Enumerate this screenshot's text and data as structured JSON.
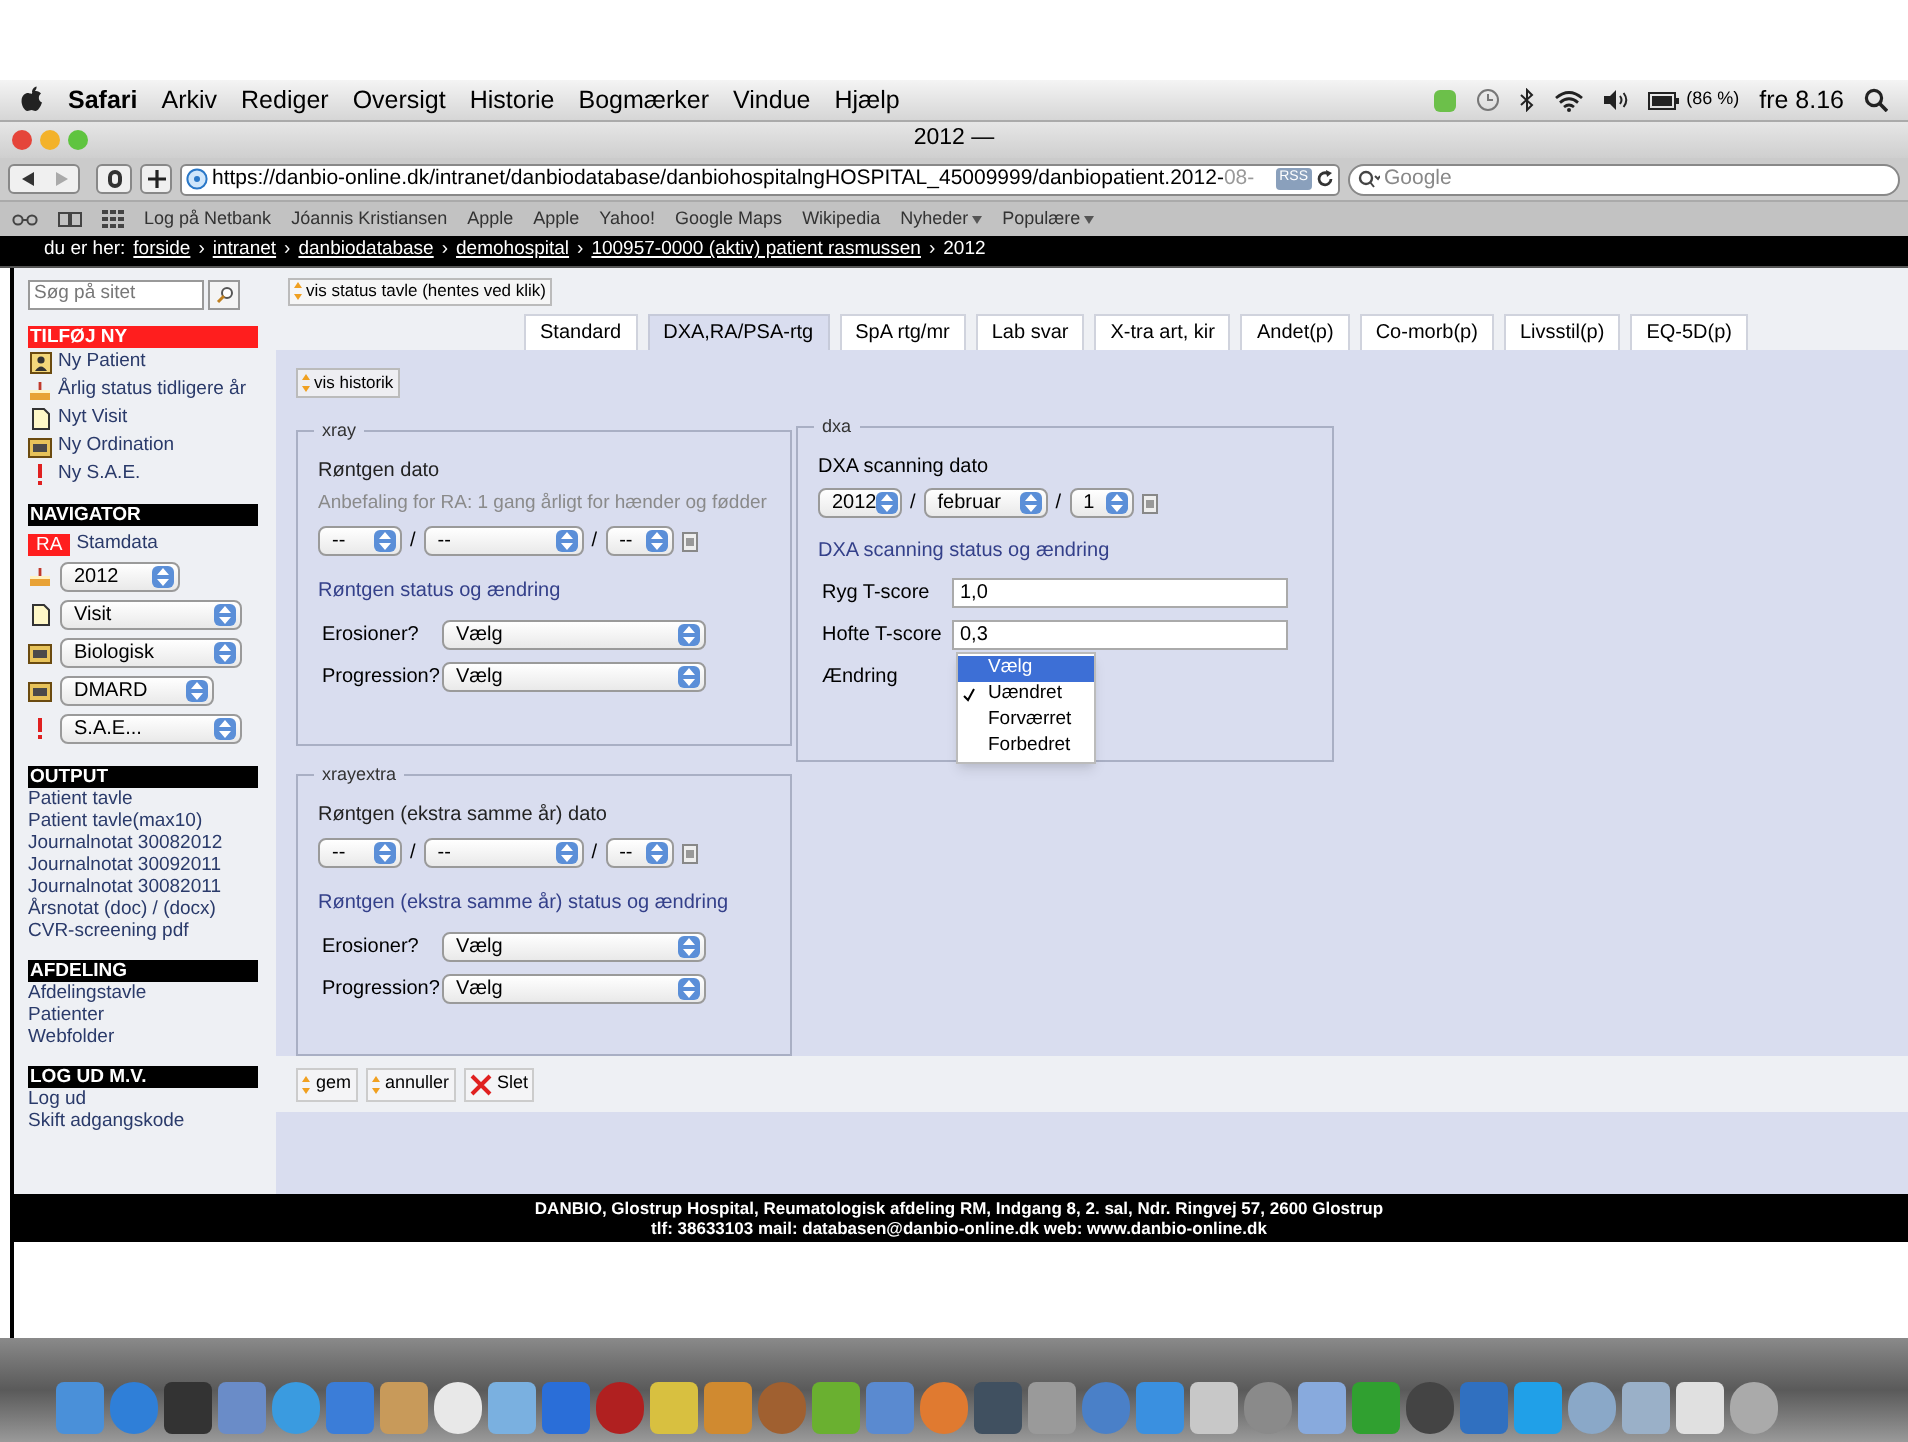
{
  "menubar": {
    "app": "Safari",
    "items": [
      "Arkiv",
      "Rediger",
      "Oversigt",
      "Historie",
      "Bogmærker",
      "Vindue",
      "Hjælp"
    ],
    "battery": "(86 %)",
    "clock": "fre 8.16"
  },
  "window": {
    "title": "2012 —"
  },
  "toolbar": {
    "url": "https://danbio-online.dk/intranet/danbiodatabase/danbiohospitalngHOSPITAL_45009999/danbiopatient.2012-",
    "url_faded": "08-",
    "rss": "RSS",
    "search_placeholder": "Google"
  },
  "bookmarks": [
    {
      "label": "Log på Netbank",
      "menu": false
    },
    {
      "label": "Jóannis Kristiansen",
      "menu": false
    },
    {
      "label": "Apple",
      "menu": false
    },
    {
      "label": "Apple",
      "menu": false
    },
    {
      "label": "Yahoo!",
      "menu": false
    },
    {
      "label": "Google Maps",
      "menu": false
    },
    {
      "label": "Wikipedia",
      "menu": false
    },
    {
      "label": "Nyheder",
      "menu": true
    },
    {
      "label": "Populære",
      "menu": true
    }
  ],
  "breadcrumb": {
    "prefix": "du er her:",
    "separator": "›",
    "links": [
      "forside",
      "intranet",
      "danbiodatabase",
      "demohospital",
      "100957-0000 (aktiv) patient rasmussen"
    ],
    "current": "2012"
  },
  "sidebar": {
    "search_placeholder": "Søg på sitet",
    "add": {
      "title": "TILFØJ NY",
      "items": [
        {
          "kind": "card",
          "label": "Ny Patient"
        },
        {
          "kind": "cake",
          "label": "Årlig status tidligere år"
        },
        {
          "kind": "document",
          "label": "Nyt Visit"
        },
        {
          "kind": "folder",
          "label": "Ny Ordination"
        },
        {
          "kind": "alert",
          "label": "Ny S.A.E."
        }
      ]
    },
    "navigator": {
      "title": "NAVIGATOR",
      "badge": "RA",
      "badge_label": "Stamdata",
      "selects": [
        {
          "kind": "cake",
          "value": "2012"
        },
        {
          "kind": "document",
          "value": "Visit"
        },
        {
          "kind": "folder",
          "value": "Biologisk"
        },
        {
          "kind": "folder",
          "value": "DMARD"
        },
        {
          "kind": "alert",
          "value": "S.A.E..."
        }
      ]
    },
    "sections": [
      {
        "title": "OUTPUT",
        "links": [
          "Patient tavle",
          "Patient tavle(max10)",
          "Journalnotat 30082012",
          "Journalnotat 30092011",
          "Journalnotat 30082011",
          "Årsnotat (doc) / (docx)",
          "CVR-screening pdf"
        ]
      },
      {
        "title": "AFDELING",
        "links": [
          "Afdelingstavle",
          "Patienter",
          "Webfolder"
        ]
      },
      {
        "title": "LOG UD M.V.",
        "links": [
          "Log ud",
          "Skift adgangskode"
        ]
      }
    ]
  },
  "status_button": "vis status tavle (hentes ved klik)",
  "tabs": [
    {
      "label": "Standard",
      "selected": false
    },
    {
      "label": "DXA,RA/PSA-rtg",
      "selected": true
    },
    {
      "label": "SpA rtg/mr",
      "selected": false
    },
    {
      "label": "Lab svar",
      "selected": false
    },
    {
      "label": "X-tra art, kir",
      "selected": false
    },
    {
      "label": "Andet(p)",
      "selected": false
    },
    {
      "label": "Co-morb(p)",
      "selected": false
    },
    {
      "label": "Livsstil(p)",
      "selected": false
    },
    {
      "label": "EQ-5D(p)",
      "selected": false
    }
  ],
  "history_button": "vis historik",
  "xray": {
    "legend": "xray",
    "date_label": "Røntgen dato",
    "hint": "Anbefaling for RA: 1 gang årligt for hænder og fødder",
    "date": [
      "--",
      "--",
      "--"
    ],
    "date_separator": "/",
    "status_title": "Røntgen status og ændring",
    "fields": [
      {
        "label": "Erosioner?",
        "value": "Vælg"
      },
      {
        "label": "Progression?",
        "value": "Vælg"
      }
    ]
  },
  "xrayextra": {
    "legend": "xrayextra",
    "date_label": "Røntgen (ekstra samme år) dato",
    "date": [
      "--",
      "--",
      "--"
    ],
    "date_separator": "/",
    "status_title": "Røntgen (ekstra samme år) status og ændring",
    "fields": [
      {
        "label": "Erosioner?",
        "value": "Vælg"
      },
      {
        "label": "Progression?",
        "value": "Vælg"
      }
    ]
  },
  "dxa": {
    "legend": "dxa",
    "date_label": "DXA scanning dato",
    "date": [
      "2012",
      "februar",
      "1"
    ],
    "date_separator": "/",
    "status_title": "DXA scanning status og ændring",
    "scores": [
      {
        "label": "Ryg T-score",
        "value": "1,0"
      },
      {
        "label": "Hofte T-score",
        "value": "0,3"
      }
    ],
    "change_label": "Ændring",
    "change_options": [
      {
        "label": "Vælg",
        "selected": true,
        "checked": false
      },
      {
        "label": "Uændret",
        "selected": false,
        "checked": true
      },
      {
        "label": "Forværret",
        "selected": false,
        "checked": false
      },
      {
        "label": "Forbedret",
        "selected": false,
        "checked": false
      }
    ]
  },
  "actions": [
    {
      "kind": "save",
      "label": "gem"
    },
    {
      "kind": "cancel",
      "label": "annuller"
    },
    {
      "kind": "delete",
      "label": "Slet"
    }
  ],
  "footer": [
    "DANBIO, Glostrup Hospital, Reumatologisk afdeling RM, Indgang 8, 2. sal, Ndr. Ringvej 57, 2600 Glostrup",
    "tlf: 38633103 mail: databasen@danbio-online.dk web: www.danbio-online.dk"
  ]
}
